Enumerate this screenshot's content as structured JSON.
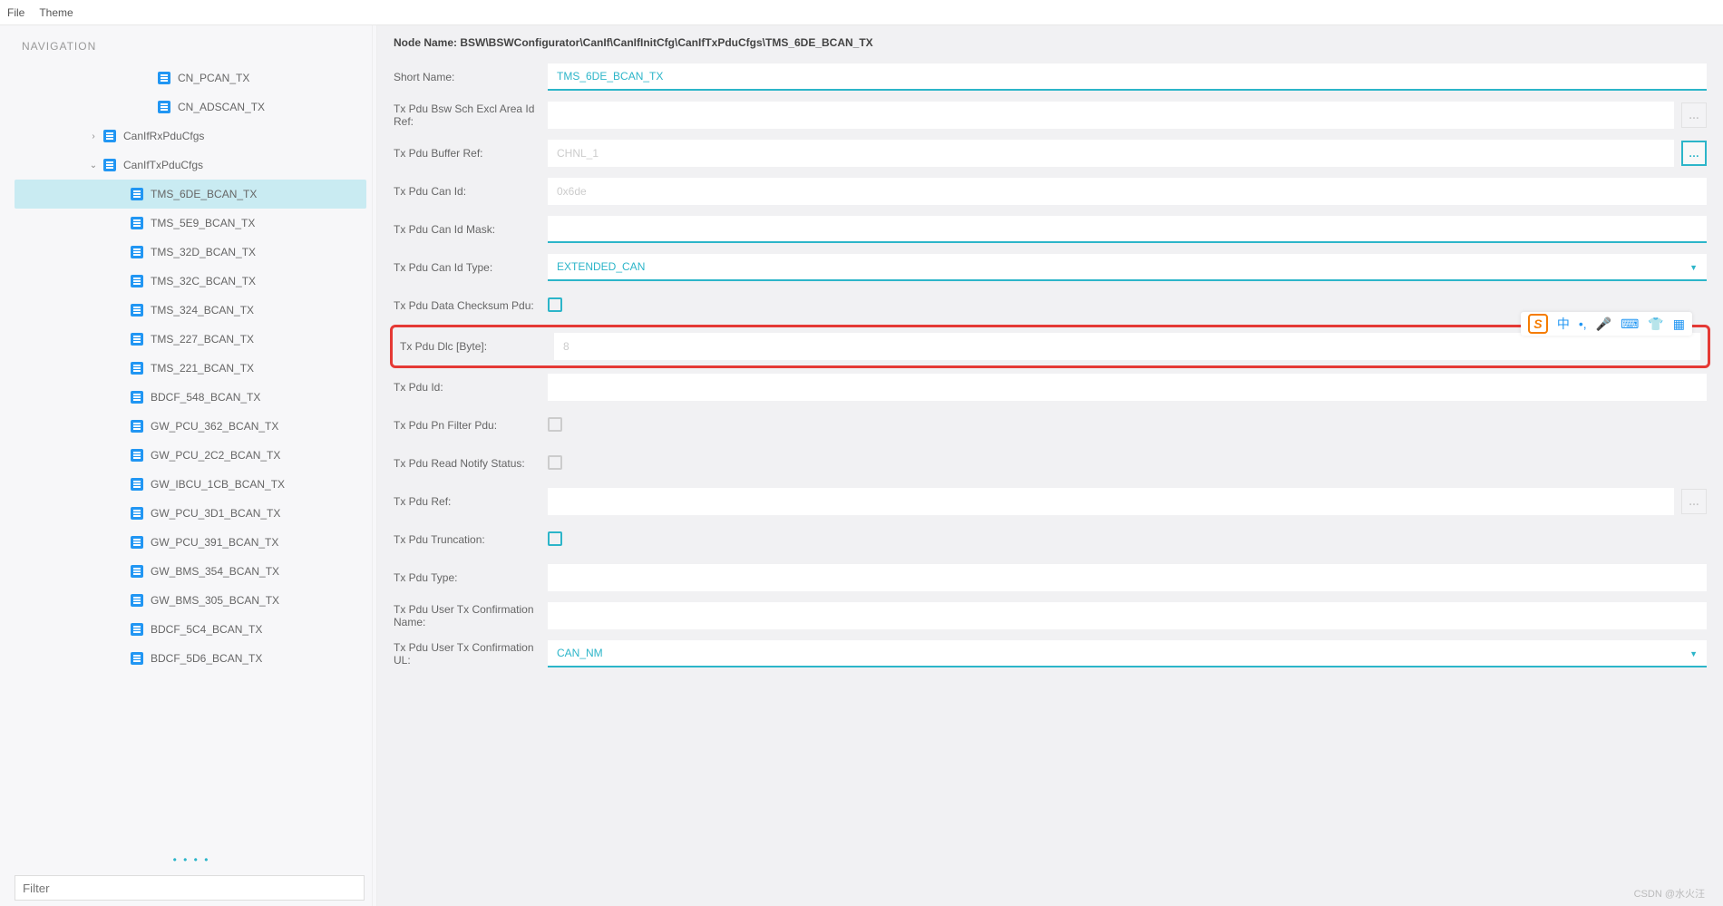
{
  "menubar": {
    "file": "File",
    "theme": "Theme"
  },
  "sidebar": {
    "title": "NAVIGATION",
    "filter_placeholder": "Filter",
    "items": [
      {
        "label": "CN_PCAN_TX",
        "indent": 140
      },
      {
        "label": "CN_ADSCAN_TX",
        "indent": 140
      },
      {
        "label": "CanIfRxPduCfgs",
        "indent": 80,
        "chev": "›"
      },
      {
        "label": "CanIfTxPduCfgs",
        "indent": 80,
        "chev": "⌄"
      },
      {
        "label": "TMS_6DE_BCAN_TX",
        "indent": 110,
        "selected": true
      },
      {
        "label": "TMS_5E9_BCAN_TX",
        "indent": 110
      },
      {
        "label": "TMS_32D_BCAN_TX",
        "indent": 110
      },
      {
        "label": "TMS_32C_BCAN_TX",
        "indent": 110
      },
      {
        "label": "TMS_324_BCAN_TX",
        "indent": 110
      },
      {
        "label": "TMS_227_BCAN_TX",
        "indent": 110
      },
      {
        "label": "TMS_221_BCAN_TX",
        "indent": 110
      },
      {
        "label": "BDCF_548_BCAN_TX",
        "indent": 110
      },
      {
        "label": "GW_PCU_362_BCAN_TX",
        "indent": 110
      },
      {
        "label": "GW_PCU_2C2_BCAN_TX",
        "indent": 110
      },
      {
        "label": "GW_IBCU_1CB_BCAN_TX",
        "indent": 110
      },
      {
        "label": "GW_PCU_3D1_BCAN_TX",
        "indent": 110
      },
      {
        "label": "GW_PCU_391_BCAN_TX",
        "indent": 110
      },
      {
        "label": "GW_BMS_354_BCAN_TX",
        "indent": 110
      },
      {
        "label": "GW_BMS_305_BCAN_TX",
        "indent": 110
      },
      {
        "label": "BDCF_5C4_BCAN_TX",
        "indent": 110
      },
      {
        "label": "BDCF_5D6_BCAN_TX",
        "indent": 110
      }
    ]
  },
  "breadcrumb": "Node Name: BSW\\BSWConfigurator\\CanIf\\CanIfInitCfg\\CanIfTxPduCfgs\\TMS_6DE_BCAN_TX",
  "form": {
    "short_name": {
      "label": "Short Name:",
      "value": "TMS_6DE_BCAN_TX"
    },
    "excl_area": {
      "label": "Tx Pdu Bsw Sch Excl Area Id Ref:",
      "value": ""
    },
    "buffer_ref": {
      "label": "Tx Pdu Buffer Ref:",
      "value": "CHNL_1"
    },
    "can_id": {
      "label": "Tx Pdu Can Id:",
      "value": "0x6de"
    },
    "can_id_mask": {
      "label": "Tx Pdu Can Id Mask:",
      "value": ""
    },
    "can_id_type": {
      "label": "Tx Pdu Can Id Type:",
      "value": "EXTENDED_CAN"
    },
    "checksum": {
      "label": "Tx Pdu Data Checksum Pdu:"
    },
    "dlc": {
      "label": "Tx Pdu Dlc [Byte]:",
      "value": "8"
    },
    "pdu_id": {
      "label": "Tx Pdu Id:",
      "value": ""
    },
    "pn_filter": {
      "label": "Tx Pdu Pn Filter Pdu:"
    },
    "read_notify": {
      "label": "Tx Pdu Read Notify Status:"
    },
    "pdu_ref": {
      "label": "Tx Pdu Ref:",
      "value": ""
    },
    "truncation": {
      "label": "Tx Pdu Truncation:"
    },
    "pdu_type": {
      "label": "Tx Pdu Type:",
      "value": ""
    },
    "conf_name": {
      "label": "Tx Pdu User Tx Confirmation Name:",
      "value": ""
    },
    "conf_ul": {
      "label": "Tx Pdu User Tx Confirmation UL:",
      "value": "CAN_NM"
    }
  },
  "watermark": "CSDN @水火汪",
  "ime": {
    "letter": "S",
    "zh": "中"
  }
}
